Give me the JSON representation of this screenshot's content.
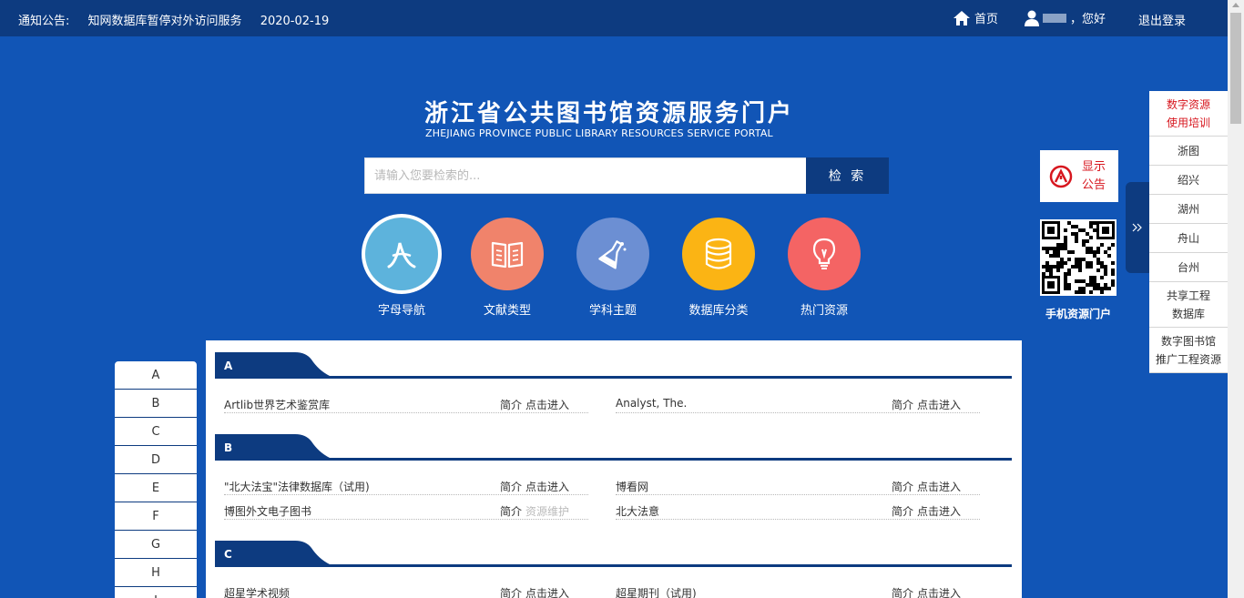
{
  "topbar": {
    "notice_label": "通知公告:",
    "notice_text": "知网数据库暂停对外访问服务",
    "notice_date": "2020-02-19",
    "home": "首页",
    "greeting": "，您好",
    "logout": "退出登录"
  },
  "portal": {
    "title_cn": "浙江省公共图书馆资源服务门户",
    "title_en": "ZHEJIANG PROVINCE PUBLIC LIBRARY RESOURCES SERVICE PORTAL"
  },
  "search": {
    "placeholder": "请输入您要检索的...",
    "button": "检 索"
  },
  "categories": [
    {
      "label": "字母导航",
      "icon": "alpha-icon",
      "color": "#5db3dc"
    },
    {
      "label": "文献类型",
      "icon": "book-icon",
      "color": "#f0836b"
    },
    {
      "label": "学科主题",
      "icon": "flask-icon",
      "color": "#6c8fd3"
    },
    {
      "label": "数据库分类",
      "icon": "database-icon",
      "color": "#fbb414"
    },
    {
      "label": "热门资源",
      "icon": "bulb-icon",
      "color": "#f46464"
    }
  ],
  "side": {
    "notice_btn_line1": "显示",
    "notice_btn_line2": "公告",
    "qr_label": "手机资源门户"
  },
  "right_menu": [
    {
      "l1": "数字资源",
      "l2": "使用培训"
    },
    {
      "l1": "浙图",
      "l2": ""
    },
    {
      "l1": "绍兴",
      "l2": ""
    },
    {
      "l1": "湖州",
      "l2": ""
    },
    {
      "l1": "舟山",
      "l2": ""
    },
    {
      "l1": "台州",
      "l2": ""
    },
    {
      "l1": "共享工程",
      "l2": "数据库"
    },
    {
      "l1": "数字图书馆",
      "l2": "推广工程资源"
    }
  ],
  "letters": [
    "A",
    "B",
    "C",
    "D",
    "E",
    "F",
    "G",
    "H",
    "I"
  ],
  "sections": [
    {
      "letter": "A",
      "items": [
        {
          "name": "Artlib世界艺术鉴赏库",
          "intro": "简介",
          "action": "点击进入"
        },
        {
          "name": "Analyst, The.",
          "intro": "简介",
          "action": "点击进入"
        }
      ]
    },
    {
      "letter": "B",
      "items": [
        {
          "name": "\"北大法宝\"法律数据库（试用)",
          "intro": "简介",
          "action": "点击进入"
        },
        {
          "name": "博看网",
          "intro": "简介",
          "action": "点击进入"
        },
        {
          "name": "博图外文电子图书",
          "intro": "简介",
          "action": "资源维护"
        },
        {
          "name": "北大法意",
          "intro": "简介",
          "action": "点击进入"
        }
      ]
    },
    {
      "letter": "C",
      "items": [
        {
          "name": "超星学术视频",
          "intro": "简介",
          "action": "点击进入"
        },
        {
          "name": "超星期刊（试用)",
          "intro": "简介",
          "action": "点击进入"
        }
      ]
    }
  ]
}
